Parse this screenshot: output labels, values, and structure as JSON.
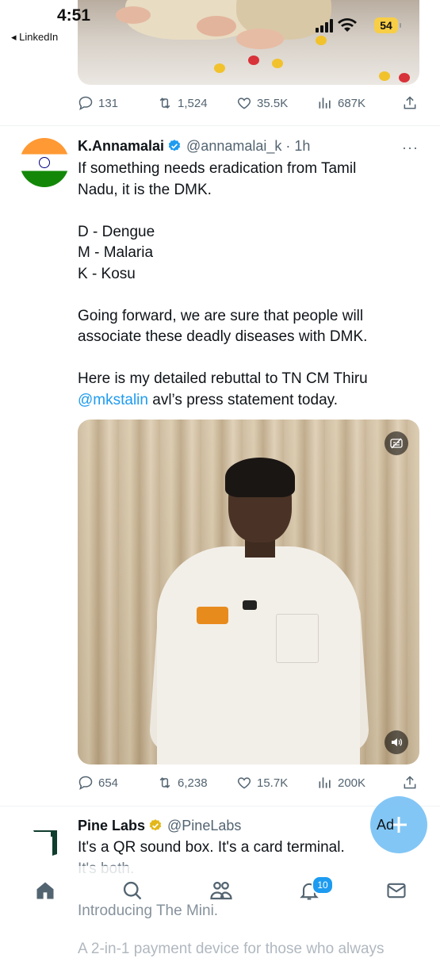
{
  "status_bar": {
    "time": "4:51",
    "back_label": "◂ LinkedIn",
    "battery": "54"
  },
  "prev_tweet": {
    "actions": {
      "replies": "131",
      "reposts": "1,524",
      "likes": "35.5K",
      "views": "687K"
    }
  },
  "tweet": {
    "author_name": "K.Annamalai",
    "handle_time": "@annamalai_k · 1h",
    "more": "···",
    "lines": {
      "l1": "If something needs eradication from Tamil",
      "l2": "Nadu, it is the DMK.",
      "l3": "D - Dengue",
      "l4": "M - Malaria",
      "l5": "K - Kosu",
      "l6": "Going forward, we are sure that people will",
      "l7": "associate these deadly diseases with DMK.",
      "l8": "Here is my detailed rebuttal to TN CM Thiru",
      "l9_mention": "@mkstalin",
      "l9_rest": " avl’s press statement today."
    },
    "actions": {
      "replies": "654",
      "reposts": "6,238",
      "likes": "15.7K",
      "views": "200K"
    }
  },
  "promoted": {
    "author_name": "Pine Labs",
    "handle": "@PineLabs",
    "line1": "It's a QR sound box. It's a card terminal.",
    "line2": "It's both.",
    "line3": "Introducing The Mini.",
    "line4": "A 2-in-1 payment device for those who always"
  },
  "fab": {
    "label": "Ad"
  },
  "bottom_nav": {
    "notifications_count": "10"
  },
  "colors": {
    "accent": "#1d9bf0",
    "muted": "#536471",
    "verified": "#1d9bf0",
    "pine_verified": "#e2b719"
  }
}
